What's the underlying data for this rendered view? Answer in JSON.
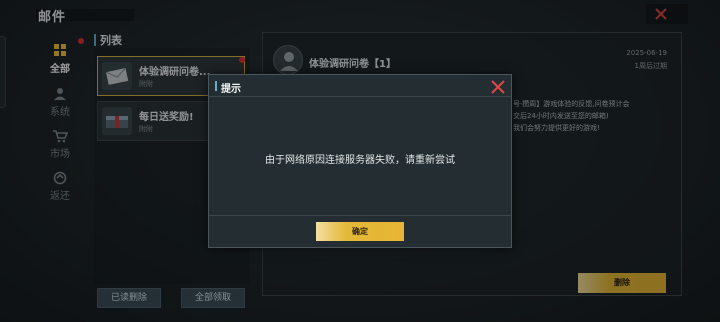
{
  "header": {
    "title": "邮件"
  },
  "sidebar": {
    "tabs": [
      {
        "label": "全部",
        "icon": "grid-icon",
        "active": true
      },
      {
        "label": "系统",
        "icon": "user-icon",
        "active": false
      },
      {
        "label": "市场",
        "icon": "cart-icon",
        "active": false
      },
      {
        "label": "返还",
        "icon": "return-icon",
        "active": false
      }
    ]
  },
  "list": {
    "title": "列表",
    "items": [
      {
        "title": "体验调研问卷...",
        "sub": "附附",
        "selected": true,
        "unread": true
      },
      {
        "title": "每日送奖励!",
        "sub": "附附",
        "selected": false,
        "unread": false
      }
    ],
    "delete_read_label": "已读删除",
    "collect_all_label": "全部领取"
  },
  "detail": {
    "title": "体验调研问卷【1】",
    "date": "2025-06-19",
    "expiry": "1周后过期",
    "body_lines": [
      "号·攒周】游戏体验的反馈,问卷预计会",
      "交后24小时内发送至您的邮箱)",
      "我们会努力提供更好的游戏!"
    ],
    "delete_label": "删除"
  },
  "modal": {
    "title": "提示",
    "message": "由于网络原因连接服务器失败，请重新尝试",
    "confirm_label": "确定"
  },
  "colors": {
    "accent_yellow": "#e6b534",
    "accent_blue": "#5fb0c8",
    "close_red": "#e04848",
    "unread_dot": "#dd3333"
  }
}
